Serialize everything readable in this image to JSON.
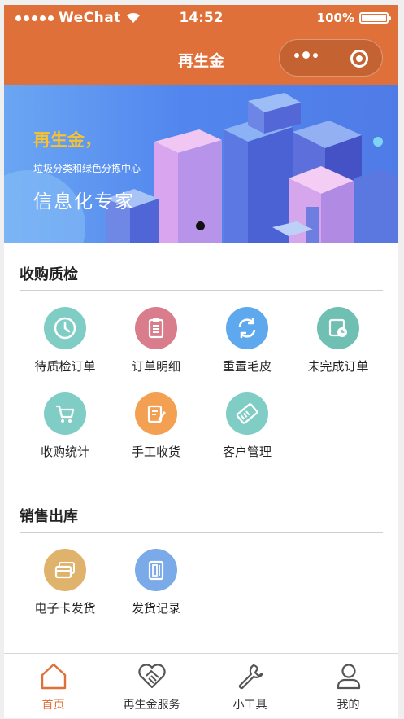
{
  "status_bar": {
    "carrier": "WeChat",
    "time": "14:52",
    "battery": "100%"
  },
  "nav": {
    "title": "再生金",
    "more_icon": "more-dots-icon",
    "close_icon": "target-icon"
  },
  "banner": {
    "headline": "再生金，",
    "subtitle": "垃圾分类和绿色分拣中心",
    "slogan": "信息化专家",
    "colors": {
      "headline": "#f6c231",
      "background": "#5286ee"
    }
  },
  "sections": [
    {
      "title": "收购质检",
      "items": [
        {
          "label": "待质检订单",
          "icon": "clock-icon",
          "color": "#7fcdc5"
        },
        {
          "label": "订单明细",
          "icon": "clipboard-icon",
          "color": "#d97c8c"
        },
        {
          "label": "重置毛皮",
          "icon": "refresh-icon",
          "color": "#5ea8ee"
        },
        {
          "label": "未完成订单",
          "icon": "photo-clock-icon",
          "color": "#6fc0b3"
        },
        {
          "label": "收购统计",
          "icon": "cart-icon",
          "color": "#7fcdc5"
        },
        {
          "label": "手工收货",
          "icon": "edit-icon",
          "color": "#f4a052"
        },
        {
          "label": "客户管理",
          "icon": "card-icon",
          "color": "#7fcdc5"
        }
      ]
    },
    {
      "title": "销售出库",
      "items": [
        {
          "label": "电子卡发货",
          "icon": "cards-icon",
          "color": "#e0b36d"
        },
        {
          "label": "发货记录",
          "icon": "document-icon",
          "color": "#7aaae8"
        }
      ]
    }
  ],
  "tabbar": {
    "active_color": "#e0703a",
    "tabs": [
      {
        "label": "首页",
        "icon": "home-icon"
      },
      {
        "label": "再生金服务",
        "icon": "handshake-icon"
      },
      {
        "label": "小工具",
        "icon": "wrench-icon"
      },
      {
        "label": "我的",
        "icon": "user-icon"
      }
    ]
  }
}
